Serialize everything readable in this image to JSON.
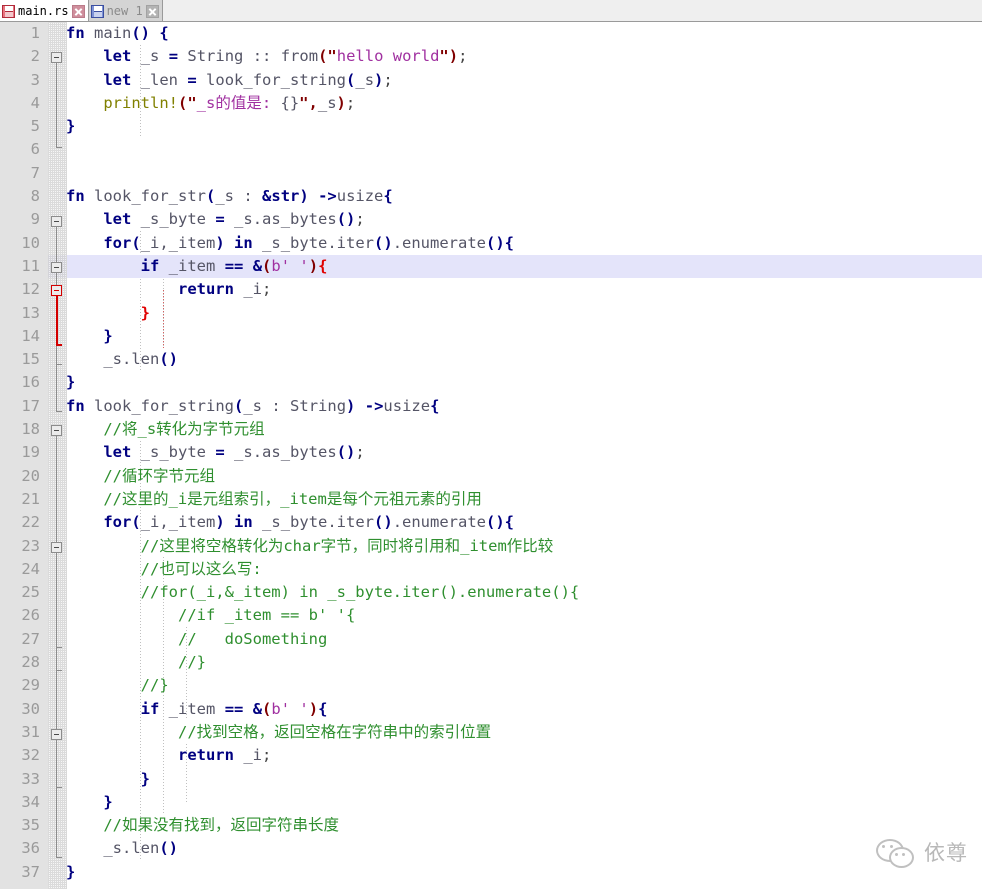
{
  "window": {
    "title": "main.rs",
    "type": "code-editor"
  },
  "tabs": [
    {
      "label": "main.rs",
      "active": true,
      "icon": "save-disk-icon-modified",
      "close_icon": "close-icon"
    },
    {
      "label": "new 1",
      "active": false,
      "icon": "save-disk-icon",
      "close_icon": "close-icon"
    }
  ],
  "colors": {
    "keyword": "#000080",
    "string": "#a030a0",
    "comment": "#2f8f2f",
    "macro": "#808000",
    "punctuation_maroon": "#800000",
    "matched_brace": "#e00000",
    "gutter_bg": "#e2e2e2",
    "line_number": "#9a9a9a",
    "current_line_highlight": "#e4e4fa",
    "editor_bg": "#ffffff"
  },
  "editor": {
    "language": "rust",
    "current_line": 11,
    "first_visible_line": 1,
    "last_visible_line": 37,
    "lines": [
      {
        "n": 1,
        "text": "fn main() {"
      },
      {
        "n": 2,
        "text": "    let _s = String :: from(\"hello world\");"
      },
      {
        "n": 3,
        "text": "    let _len = look_for_string(_s);"
      },
      {
        "n": 4,
        "text": "    println!(\"_s的值是: {}\",_s);"
      },
      {
        "n": 5,
        "text": "}"
      },
      {
        "n": 6,
        "text": ""
      },
      {
        "n": 7,
        "text": ""
      },
      {
        "n": 8,
        "text": "fn look_for_str(_s : &str) ->usize{"
      },
      {
        "n": 9,
        "text": "    let _s_byte = _s.as_bytes();"
      },
      {
        "n": 10,
        "text": "    for(_i,_item) in _s_byte.iter().enumerate(){"
      },
      {
        "n": 11,
        "text": "        if _item == &(b' '){"
      },
      {
        "n": 12,
        "text": "            return _i;"
      },
      {
        "n": 13,
        "text": "        }"
      },
      {
        "n": 14,
        "text": "    }"
      },
      {
        "n": 15,
        "text": "    _s.len()"
      },
      {
        "n": 16,
        "text": "}"
      },
      {
        "n": 17,
        "text": "fn look_for_string(_s : String) ->usize{"
      },
      {
        "n": 18,
        "text": "    //将_s转化为字节元组"
      },
      {
        "n": 19,
        "text": "    let _s_byte = _s.as_bytes();"
      },
      {
        "n": 20,
        "text": "    //循环字节元组"
      },
      {
        "n": 21,
        "text": "    //这里的_i是元组索引，_item是每个元祖元素的引用"
      },
      {
        "n": 22,
        "text": "    for(_i,_item) in _s_byte.iter().enumerate(){"
      },
      {
        "n": 23,
        "text": "        //这里将空格转化为char字节，同时将引用和_item作比较"
      },
      {
        "n": 24,
        "text": "        //也可以这么写:"
      },
      {
        "n": 25,
        "text": "        //for(_i,&_item) in _s_byte.iter().enumerate(){"
      },
      {
        "n": 26,
        "text": "            //if _item == b' '{"
      },
      {
        "n": 27,
        "text": "            //   doSomething"
      },
      {
        "n": 28,
        "text": "            //}"
      },
      {
        "n": 29,
        "text": "        //}"
      },
      {
        "n": 30,
        "text": "        if _item == &(b' '){"
      },
      {
        "n": 31,
        "text": "            //找到空格，返回空格在字符串中的索引位置"
      },
      {
        "n": 32,
        "text": "            return _i;"
      },
      {
        "n": 33,
        "text": "        }"
      },
      {
        "n": 34,
        "text": "    }"
      },
      {
        "n": 35,
        "text": "    //如果没有找到，返回字符串长度"
      },
      {
        "n": 36,
        "text": "    _s.len()"
      },
      {
        "n": 37,
        "text": "}"
      }
    ],
    "fold_markers": [
      {
        "line": 1,
        "state": "expanded",
        "color": "grey"
      },
      {
        "line": 8,
        "state": "expanded",
        "color": "grey"
      },
      {
        "line": 10,
        "state": "expanded",
        "color": "grey"
      },
      {
        "line": 11,
        "state": "expanded",
        "color": "red"
      },
      {
        "line": 17,
        "state": "expanded",
        "color": "grey"
      },
      {
        "line": 22,
        "state": "expanded",
        "color": "grey"
      },
      {
        "line": 30,
        "state": "expanded",
        "color": "grey"
      }
    ]
  },
  "watermark": {
    "text": "依尊",
    "icon": "wechat-icon"
  }
}
